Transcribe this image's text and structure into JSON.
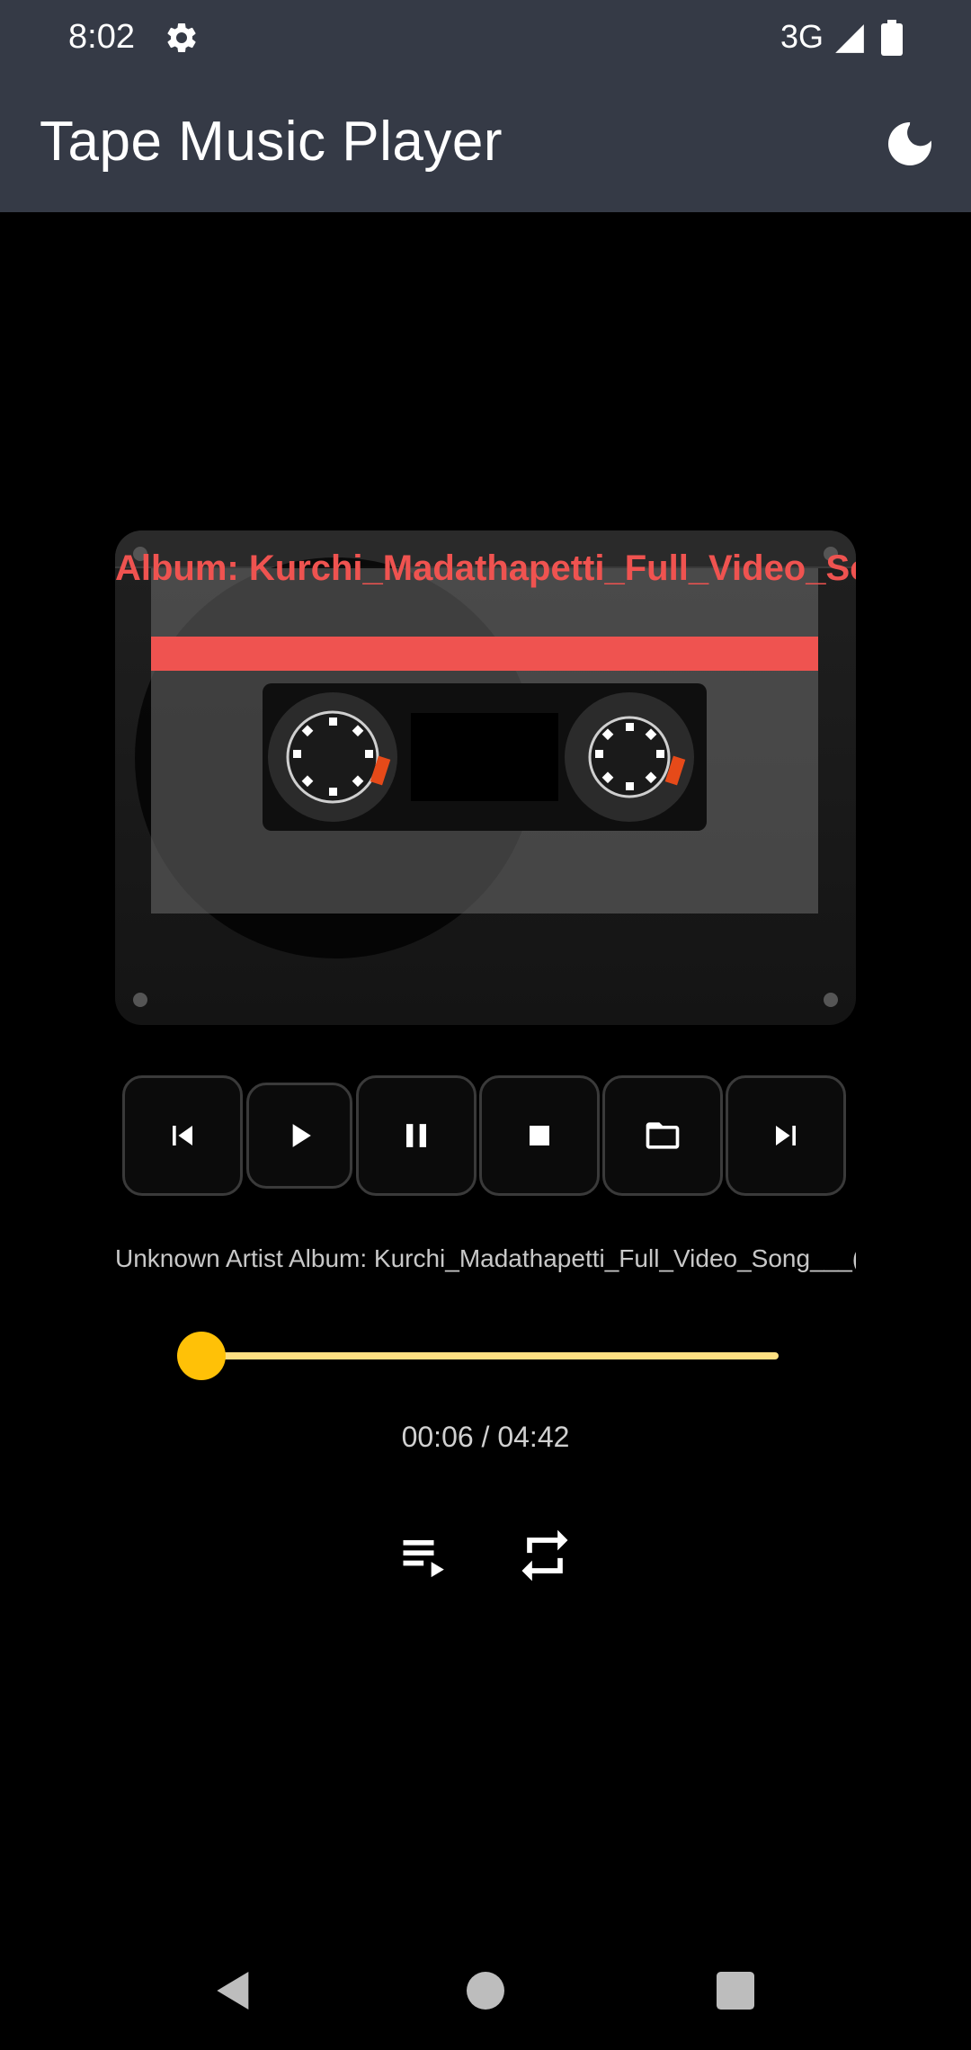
{
  "status": {
    "time": "8:02",
    "network": "3G",
    "icons": [
      "settings-icon",
      "signal-icon",
      "battery-icon"
    ]
  },
  "app": {
    "title": "Tape Music Player",
    "theme_icon": "moon-icon"
  },
  "cassette": {
    "label_text": "Album: Kurchi_Madathapetti_Full_Video_Song___"
  },
  "controls": {
    "buttons": [
      "skip-previous-icon",
      "play-icon",
      "pause-icon",
      "stop-icon",
      "folder-icon",
      "skip-next-icon"
    ]
  },
  "track": {
    "info": "Unknown Artist Album: Kurchi_Madathapetti_Full_Video_Song___("
  },
  "playback": {
    "elapsed": "00:06",
    "total": "04:42",
    "time_text": "00:06 / 04:42",
    "progress_fraction": 0.021
  },
  "extras": [
    "playlist-icon",
    "repeat-icon"
  ],
  "colors": {
    "bar": "#353a46",
    "accent": "#ffc107",
    "track": "#ffe082",
    "label": "#ef5350"
  },
  "nav": [
    "back-icon",
    "home-icon",
    "recents-icon"
  ]
}
